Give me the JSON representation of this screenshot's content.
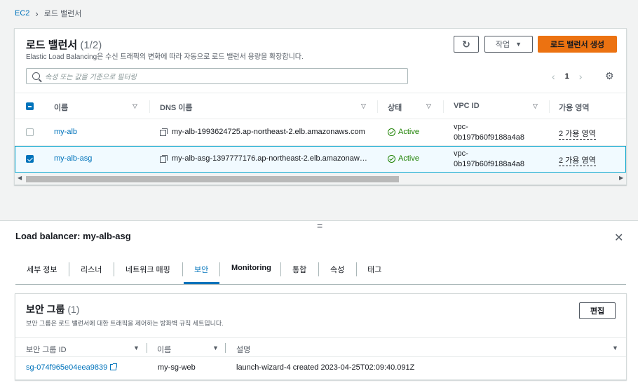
{
  "breadcrumb": {
    "root": "EC2",
    "current": "로드 밸런서"
  },
  "list": {
    "title": "로드 밸런서",
    "count": "(1/2)",
    "description": "Elastic Load Balancing은 수신 트래픽의 변화에 따라 자동으로 로드 밸런서 용량을 확장합니다.",
    "action_label": "작업",
    "create_label": "로드 밸런서 생성",
    "search_placeholder": "속성 또는 값을 기준으로 필터링",
    "page": "1",
    "columns": [
      "이름",
      "DNS 이름",
      "상태",
      "VPC ID",
      "가용 영역"
    ],
    "rows": [
      {
        "name": "my-alb",
        "dns": "my-alb-1993624725.ap-northeast-2.elb.amazonaws.com",
        "status": "Active",
        "vpc_line1": "vpc-",
        "vpc_line2": "0b197b60f9188a4a8",
        "az": "2 가용 영역",
        "selected": false
      },
      {
        "name": "my-alb-asg",
        "dns": "my-alb-asg-1397777176.ap-northeast-2.elb.amazonaw…",
        "status": "Active",
        "vpc_line1": "vpc-",
        "vpc_line2": "0b197b60f9188a4a8",
        "az": "2 가용 영역",
        "selected": true
      }
    ]
  },
  "detail": {
    "title": "Load balancer: my-alb-asg",
    "tabs": [
      "세부 정보",
      "리스너",
      "네트워크 매핑",
      "보안",
      "Monitoring",
      "통합",
      "속성",
      "태그"
    ],
    "active_tab": "보안",
    "security_groups": {
      "title": "보안 그룹",
      "count": "(1)",
      "description": "보안 그룹은 로드 밸런서에 대한 트래픽을 제어하는 방화벽 규칙 세트입니다.",
      "edit_label": "편집",
      "columns": [
        "보안 그룹 ID",
        "이름",
        "설명"
      ],
      "rows": [
        {
          "id": "sg-074f965e04eea9839",
          "name": "my-sg-web",
          "description": "launch-wizard-4 created 2023-04-25T02:09:40.091Z"
        }
      ]
    }
  },
  "colors": {
    "accent": "#0073bb",
    "primary_button": "#ec7211",
    "success": "#1d8102",
    "selected_row": "#f1faff"
  }
}
